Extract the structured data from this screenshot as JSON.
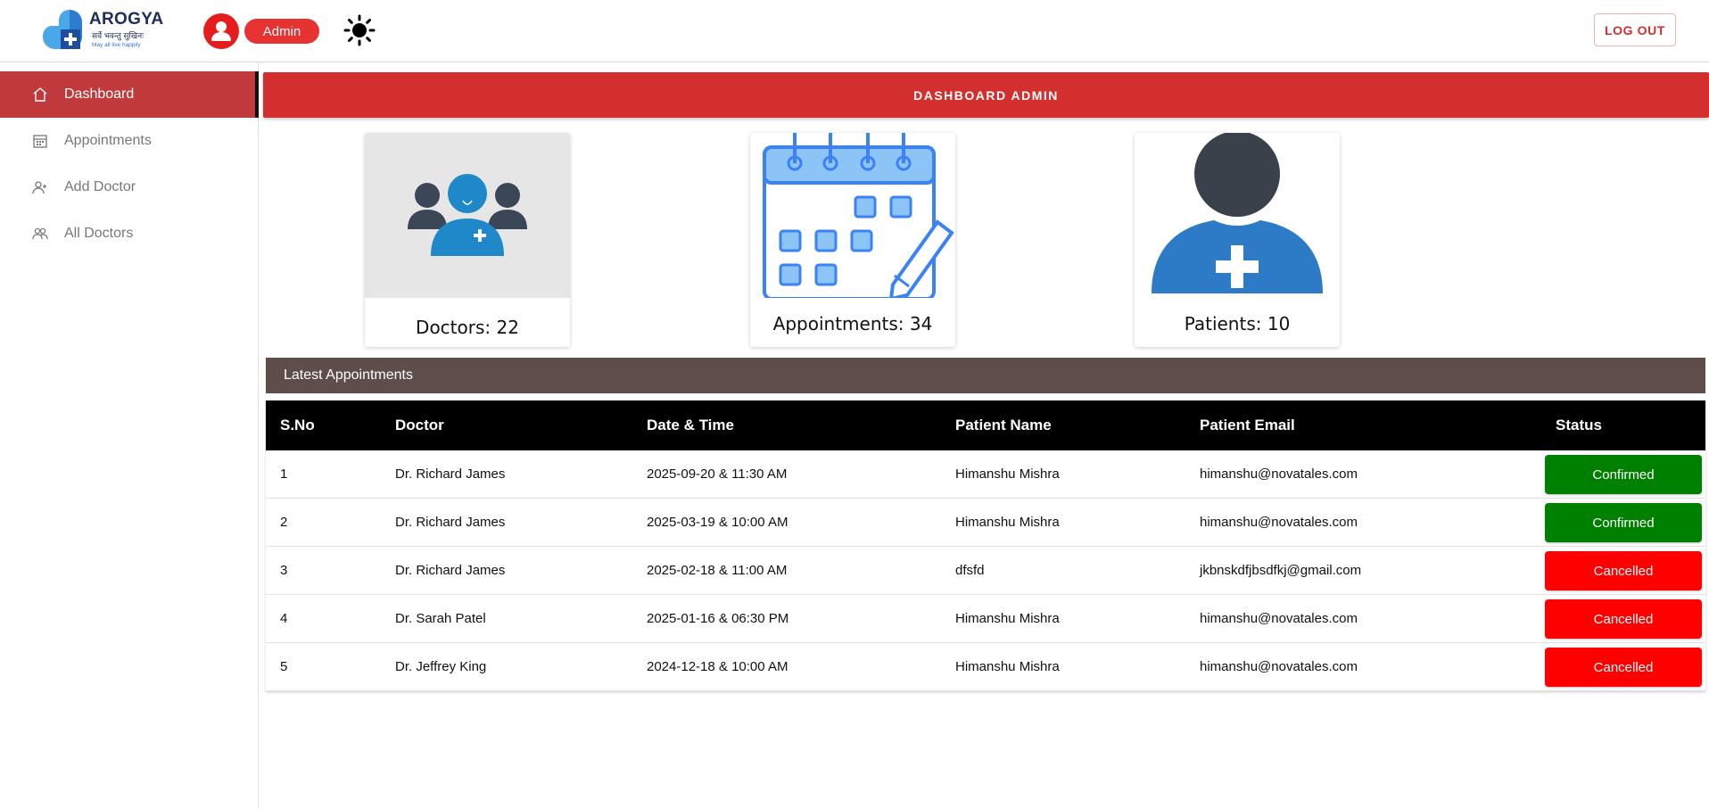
{
  "header": {
    "logo": {
      "name": "AROGYA",
      "tagline": "सर्वे भवन्तु सुखिनः",
      "tagline_en": "May all live happily"
    },
    "user": {
      "role": "Admin",
      "avatar_icon": "user-circle-icon",
      "avatar_color": "#e51d1d"
    },
    "theme_toggle_icon": "sun-icon",
    "logout_label": "LOG OUT"
  },
  "sidebar": {
    "items": [
      {
        "label": "Dashboard",
        "icon": "home-icon",
        "active": true
      },
      {
        "label": "Appointments",
        "icon": "calendar-icon",
        "active": false
      },
      {
        "label": "Add Doctor",
        "icon": "user-plus-icon",
        "active": false
      },
      {
        "label": "All Doctors",
        "icon": "users-icon",
        "active": false
      }
    ]
  },
  "main": {
    "banner_title": "DASHBOARD ADMIN",
    "stats": [
      {
        "label": "Doctors: 22",
        "icon": "doctors-group-icon"
      },
      {
        "label": "Appointments: 34",
        "icon": "calendar-edit-icon"
      },
      {
        "label": "Patients: 10",
        "icon": "patient-icon"
      }
    ],
    "latest_title": "Latest Appointments",
    "table": {
      "columns": [
        "S.No",
        "Doctor",
        "Date & Time",
        "Patient Name",
        "Patient Email",
        "Status"
      ],
      "rows": [
        {
          "sno": "1",
          "doctor": "Dr. Richard James",
          "datetime": "2025-09-20 & 11:30 AM",
          "patient": "Himanshu Mishra",
          "email": "himanshu@novatales.com",
          "status": "Confirmed"
        },
        {
          "sno": "2",
          "doctor": "Dr. Richard James",
          "datetime": "2025-03-19 & 10:00 AM",
          "patient": "Himanshu Mishra",
          "email": "himanshu@novatales.com",
          "status": "Confirmed"
        },
        {
          "sno": "3",
          "doctor": "Dr. Richard James",
          "datetime": "2025-02-18 & 11:00 AM",
          "patient": "dfsfd",
          "email": "jkbnskdfjbsdfkj@gmail.com",
          "status": "Cancelled"
        },
        {
          "sno": "4",
          "doctor": "Dr. Sarah Patel",
          "datetime": "2025-01-16 & 06:30 PM",
          "patient": "Himanshu Mishra",
          "email": "himanshu@novatales.com",
          "status": "Cancelled"
        },
        {
          "sno": "5",
          "doctor": "Dr. Jeffrey King",
          "datetime": "2024-12-18 & 10:00 AM",
          "patient": "Himanshu Mishra",
          "email": "himanshu@novatales.com",
          "status": "Cancelled"
        }
      ]
    }
  },
  "colors": {
    "primary_red": "#d32f2f",
    "sidebar_active": "#c0393b",
    "section_header": "#5f4d4c",
    "confirmed": "#008000",
    "cancelled": "#ff0000",
    "icon_blue": "#3b82f6"
  }
}
